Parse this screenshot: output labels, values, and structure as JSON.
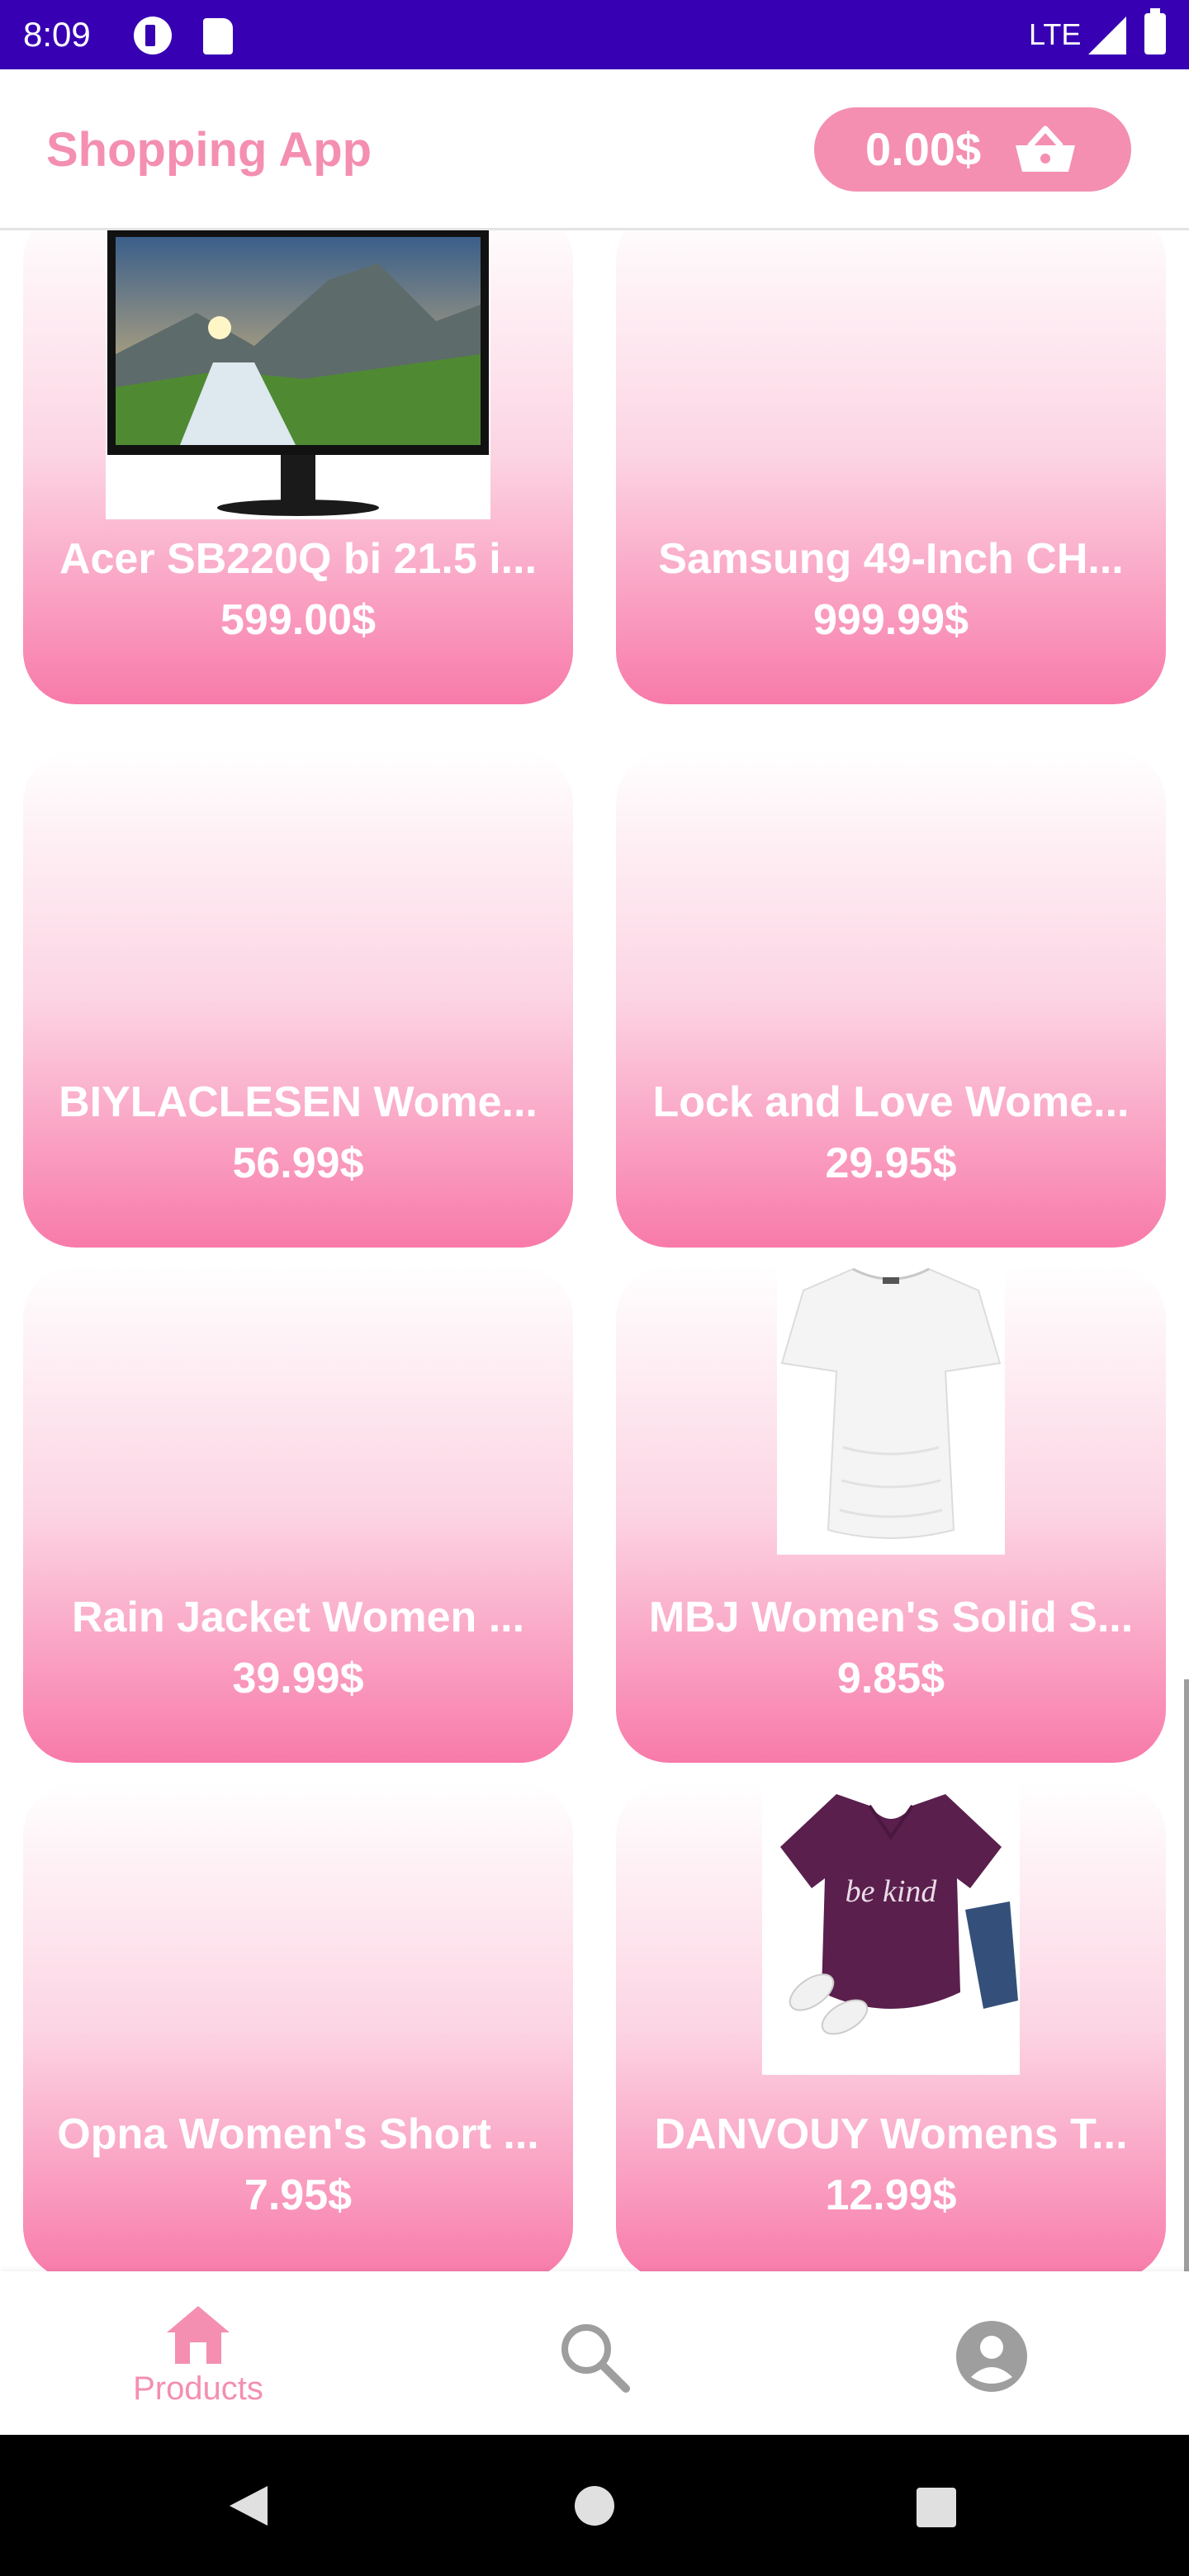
{
  "status_bar": {
    "time": "8:09",
    "network": "LTE"
  },
  "header": {
    "title": "Shopping App",
    "cart_total": "0.00$"
  },
  "products": [
    {
      "name": "Acer SB220Q bi 21.5 i...",
      "price": "599.00$",
      "image": "monitor"
    },
    {
      "name": "Samsung 49-Inch CH...",
      "price": "999.99$",
      "image": "none"
    },
    {
      "name": "BIYLACLESEN Wome...",
      "price": "56.99$",
      "image": "none"
    },
    {
      "name": "Lock and Love Wome...",
      "price": "29.95$",
      "image": "none"
    },
    {
      "name": "Rain Jacket Women ...",
      "price": "39.99$",
      "image": "none"
    },
    {
      "name": "MBJ Women's Solid S...",
      "price": "9.85$",
      "image": "white-tshirt"
    },
    {
      "name": "Opna Women's Short ...",
      "price": "7.95$",
      "image": "none"
    },
    {
      "name": "DANVOUY Womens T...",
      "price": "12.99$",
      "image": "purple-tshirt"
    }
  ],
  "tshirt_print": "be kind",
  "bottom_nav": {
    "items": [
      {
        "label": "Products",
        "icon": "home-icon",
        "active": true
      },
      {
        "label": "",
        "icon": "search-icon",
        "active": false
      },
      {
        "label": "",
        "icon": "account-icon",
        "active": false
      }
    ]
  },
  "colors": {
    "accent": "#f48fb1",
    "status_bar": "#3700b3",
    "card_bottom": "#f87aa9"
  }
}
